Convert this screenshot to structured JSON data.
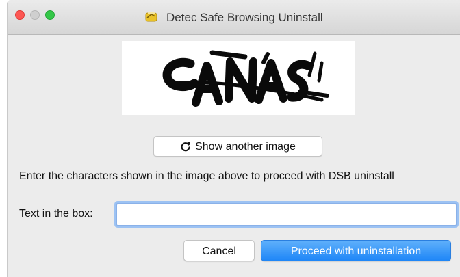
{
  "window": {
    "title": "Detec Safe Browsing Uninstall"
  },
  "captcha": {
    "text": "CANAS"
  },
  "buttons": {
    "refresh_label": "Show another image",
    "cancel_label": "Cancel",
    "proceed_label": "Proceed with uninstallation"
  },
  "form": {
    "instruction": "Enter the characters shown in the image above to proceed with DSB uninstall",
    "field_label": "Text in the box:",
    "field_value": ""
  },
  "colors": {
    "primary_button": "#1e86f7",
    "close_light": "#fc5753",
    "maximize_light": "#34c748",
    "focus_ring": "#9cc2f3"
  },
  "icons": {
    "title": "app-icon",
    "refresh": "refresh-icon"
  }
}
